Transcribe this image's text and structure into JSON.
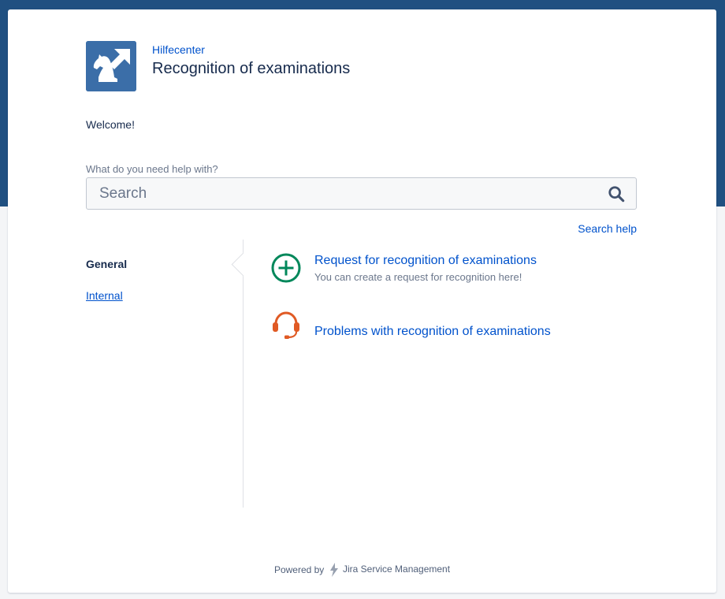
{
  "portal": {
    "breadcrumb": "Hilfecenter",
    "title": "Recognition of examinations",
    "welcome": "Welcome!"
  },
  "search": {
    "label": "What do you need help with?",
    "placeholder": "Search",
    "help_link": "Search help"
  },
  "nav": {
    "items": [
      {
        "label": "General",
        "active": true
      },
      {
        "label": "Internal",
        "active": false
      }
    ]
  },
  "requests": [
    {
      "icon": "plus-circle-icon",
      "title": "Request for recognition of examinations",
      "description": "You can create a request for recognition here!"
    },
    {
      "icon": "headset-icon",
      "title": "Problems with recognition of examinations",
      "description": ""
    }
  ],
  "footer": {
    "powered_by": "Powered by",
    "product": "Jira Service Management"
  },
  "colors": {
    "banner": "#205081",
    "link": "#0052cc",
    "text": "#172b4d",
    "plus_icon": "#00875a",
    "headset_icon": "#e05a24"
  }
}
